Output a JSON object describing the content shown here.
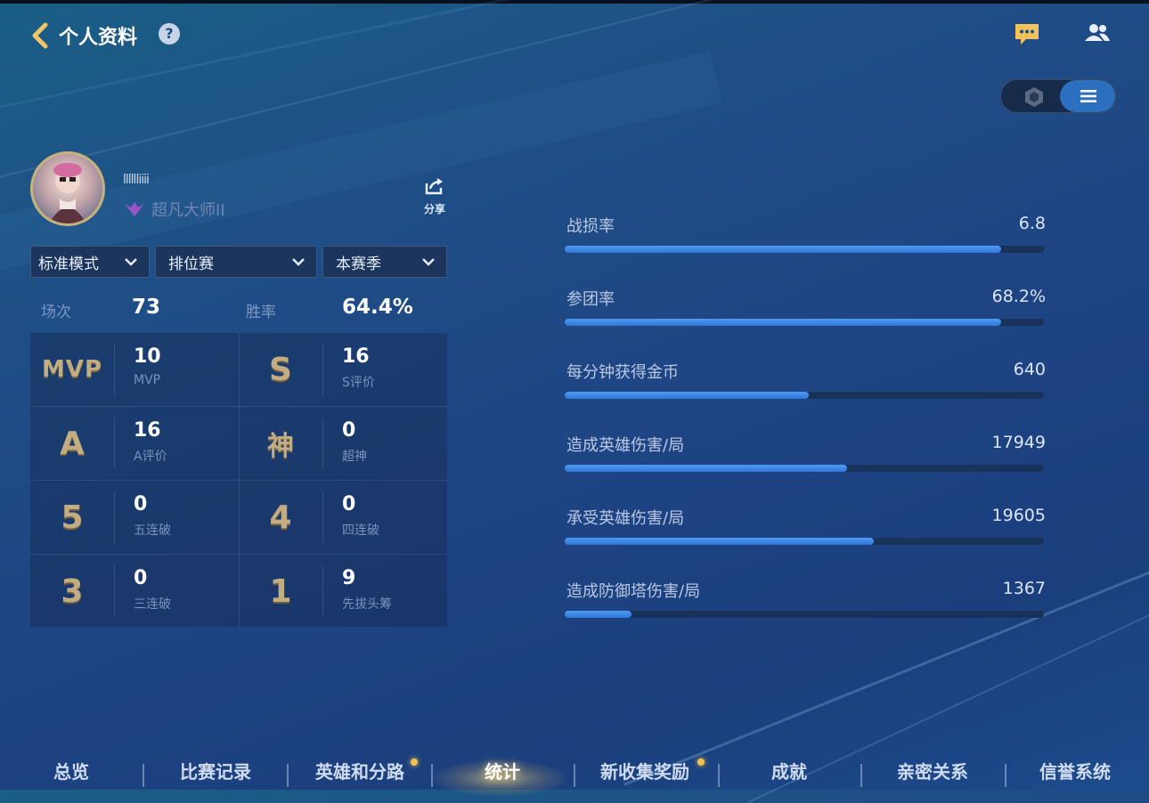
{
  "header": {
    "title": "个人资料",
    "help": "?"
  },
  "profile": {
    "name": "lllllliiii",
    "rank": "超凡大师II",
    "share_label": "分享"
  },
  "filters": {
    "mode": "标准模式",
    "match_type": "排位赛",
    "season": "本赛季"
  },
  "summary": {
    "games_label": "场次",
    "games_value": "73",
    "winrate_label": "胜率",
    "winrate_value": "64.4%"
  },
  "stats": [
    {
      "badge": "MVP",
      "value": "10",
      "label": "MVP"
    },
    {
      "badge": "S",
      "value": "16",
      "label": "S评价"
    },
    {
      "badge": "A",
      "value": "16",
      "label": "A评价"
    },
    {
      "badge": "神",
      "value": "0",
      "label": "超神"
    },
    {
      "badge": "5",
      "value": "0",
      "label": "五连破"
    },
    {
      "badge": "4",
      "value": "0",
      "label": "四连破"
    },
    {
      "badge": "3",
      "value": "0",
      "label": "三连破"
    },
    {
      "badge": "1",
      "value": "9",
      "label": "先拔头筹"
    }
  ],
  "metrics": [
    {
      "label": "战损率",
      "value": "6.8",
      "fill": 0.91
    },
    {
      "label": "参团率",
      "value": "68.2%",
      "fill": 0.91
    },
    {
      "label": "每分钟获得金币",
      "value": "640",
      "fill": 0.51
    },
    {
      "label": "造成英雄伤害/局",
      "value": "17949",
      "fill": 0.59
    },
    {
      "label": "承受英雄伤害/局",
      "value": "19605",
      "fill": 0.645
    },
    {
      "label": "造成防御塔伤害/局",
      "value": "1367",
      "fill": 0.14
    }
  ],
  "tabs": [
    {
      "label": "总览",
      "active": false,
      "dot": false
    },
    {
      "label": "比赛记录",
      "active": false,
      "dot": false
    },
    {
      "label": "英雄和分路",
      "active": false,
      "dot": true
    },
    {
      "label": "统计",
      "active": true,
      "dot": false
    },
    {
      "label": "新收集奖励",
      "active": false,
      "dot": true
    },
    {
      "label": "成就",
      "active": false,
      "dot": false
    },
    {
      "label": "亲密关系",
      "active": false,
      "dot": false
    },
    {
      "label": "信誉系统",
      "active": false,
      "dot": false
    }
  ],
  "colors": {
    "accent_bar": "#3a86e6",
    "gold_badge": "#c2ac82",
    "active_toggle": "#2d6fbf"
  },
  "icons": {
    "back": "chevron-left-icon",
    "help": "question-circle-icon",
    "chat": "chat-bubble-icon",
    "friends": "friends-icon",
    "share": "share-icon",
    "rank": "rank-wings-icon",
    "toggle_hex": "hexagon-icon",
    "toggle_list": "list-icon"
  }
}
